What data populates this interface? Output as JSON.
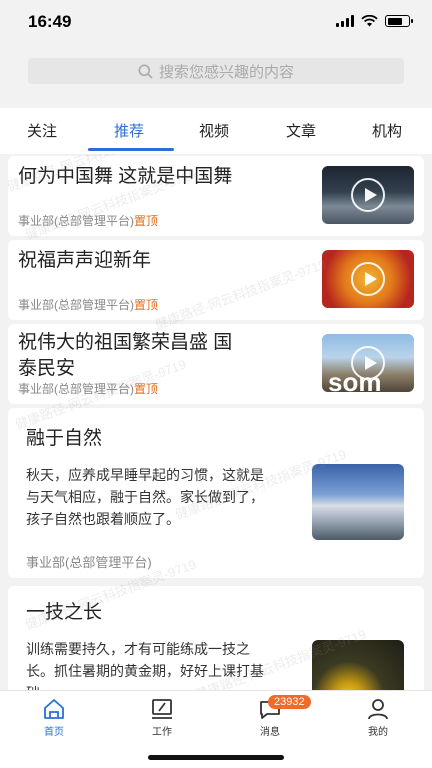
{
  "status": {
    "time": "16:49"
  },
  "search": {
    "placeholder": "搜索您感兴趣的内容"
  },
  "tabs": [
    {
      "label": "关注",
      "active": false
    },
    {
      "label": "推荐",
      "active": true
    },
    {
      "label": "视频",
      "active": false
    },
    {
      "label": "文章",
      "active": false
    },
    {
      "label": "机构",
      "active": false
    }
  ],
  "feed": [
    {
      "title": "何为中国舞 这就是中国舞",
      "source": "事业部(总部管理平台)",
      "tag": "置顶",
      "type": "video",
      "thumb_icon": "play-icon"
    },
    {
      "title": "祝福声声迎新年",
      "source": "事业部(总部管理平台)",
      "tag": "置顶",
      "type": "video",
      "thumb_icon": "play-icon"
    },
    {
      "title_line1": "祝伟大的祖国繁荣昌盛 国",
      "title_line2": "泰民安",
      "source": "事业部(总部管理平台)",
      "tag": "置顶",
      "type": "video",
      "thumb_icon": "play-icon",
      "thumb_text": "som"
    },
    {
      "title": "融于自然",
      "desc_lines": [
        "秋天，应养成早睡早起的习惯，这就是",
        "与天气相应，融于自然。家长做到了，",
        "孩子自然也跟着顺应了。"
      ],
      "source": "事业部(总部管理平台)",
      "type": "article"
    },
    {
      "title": "一技之长",
      "desc_lines": [
        "训练需要持久，才有可能练成一技之",
        "长。抓住暑期的黄金期，好好上课打基",
        "础。"
      ],
      "type": "article"
    }
  ],
  "tabbar": [
    {
      "label": "首页",
      "icon": "home-icon",
      "active": true
    },
    {
      "label": "工作",
      "icon": "work-icon",
      "active": false
    },
    {
      "label": "消息",
      "icon": "message-icon",
      "active": false,
      "badge": "23932"
    },
    {
      "label": "我的",
      "icon": "profile-icon",
      "active": false
    }
  ],
  "watermark": "健康路径-网云科技指案灵-9719",
  "colors": {
    "accent": "#2b6fd6",
    "pin": "#e26c1d",
    "badge": "#f06a2a"
  }
}
